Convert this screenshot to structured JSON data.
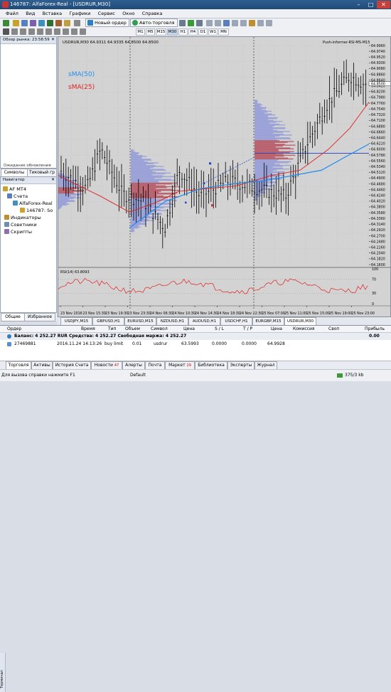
{
  "window": {
    "title": "146787: AlfaForex-Real - [USDRUR,M30]"
  },
  "menu": [
    "Файл",
    "Вид",
    "Вставка",
    "Графики",
    "Сервис",
    "Окно",
    "Справка"
  ],
  "toolbar": {
    "new_order": "Новый ордер",
    "auto_trading": "Авто-торговля",
    "timeframes": [
      "M1",
      "M5",
      "M15",
      "M30",
      "H1",
      "H4",
      "D1",
      "W1",
      "MN"
    ]
  },
  "market_watch": {
    "title": "Обзор рынка: 23:58:59",
    "status": "Ожидание обновления",
    "tabs": [
      "Символы",
      "Тиковый гр"
    ]
  },
  "navigator": {
    "title": "Навигатор",
    "items": [
      "AF MT4",
      "Счета",
      "AlfaForex-Real",
      "146787: So",
      "Индикаторы",
      "Советники",
      "Скрипты"
    ],
    "tabs": [
      "Общие",
      "Избранное"
    ]
  },
  "chart": {
    "header": "USDRUR,M30  64.9311 64.9335 64.8500 64.8500",
    "push_label": "Push-informer-RSI-MS-M15",
    "sma50_label": "sMA(50)",
    "sma25_label": "sMA(25)",
    "rsi_label": "RSI(14) 63.8093",
    "price_ticks": [
      "64.9960",
      "64.9740",
      "64.9520",
      "64.9300",
      "64.9080",
      "64.8860",
      "64.8640",
      "64.8420",
      "64.8200",
      "64.7980",
      "64.7760",
      "64.7540",
      "64.7320",
      "64.7100",
      "64.6880",
      "64.6660",
      "64.6440",
      "64.6220",
      "64.6000",
      "64.5780",
      "64.5560",
      "64.5340",
      "64.5120",
      "64.4900",
      "64.4680",
      "64.4460",
      "64.4240",
      "64.4020",
      "64.3800",
      "64.3580",
      "64.3360",
      "64.3140",
      "64.2920",
      "64.2700",
      "64.2480",
      "64.2260",
      "64.2040",
      "64.1820",
      "64.1600"
    ],
    "current_price": "64.8500",
    "rsi_ticks": [
      "100",
      "70",
      "30",
      "0"
    ],
    "time_ticks": [
      "23 Nov 2016",
      "23 Nov 15:30",
      "23 Nov 19:30",
      "23 Nov 23:30",
      "24 Nov 06:30",
      "24 Nov 10:30",
      "24 Nov 14:30",
      "24 Nov 18:30",
      "24 Nov 22:30",
      "25 Nov 07:00",
      "25 Nov 11:00",
      "25 Nov 15:00",
      "25 Nov 19:00",
      "25 Nov 23:00"
    ],
    "symbol_tabs": [
      "USDJPY,M15",
      "GBPUSD,H1",
      "EURUSD,M15",
      "NZDUSD,H1",
      "AUDUSD,H1",
      "USDCHF,H1",
      "EURGBP,M15",
      "USDRUR,M30"
    ],
    "colors": {
      "bg": "#d3d3d3",
      "candle": "#000000",
      "sma50": "#1e8cf0",
      "sma25": "#e02020",
      "profile": "#b04050"
    }
  },
  "terminal": {
    "headers": [
      "Ордер",
      "Время",
      "Тип",
      "Объем",
      "Символ",
      "Цена",
      "S / L",
      "T / P",
      "Цена",
      "Комиссия",
      "Своп",
      "Прибыль"
    ],
    "balance_line": "Баланс: 4 252.27 RUR  Средства: 4 252.27  Свободная маржа: 4 252.27",
    "balance_profit": "0.00",
    "order": {
      "id": "27469881",
      "time": "2016.11.24 14:13:26",
      "type": "buy limit",
      "volume": "0.01",
      "symbol": "usdrur",
      "price": "63.5993",
      "sl": "0.0000",
      "tp": "0.0000",
      "cur_price": "64.9928"
    },
    "side_label": "Терминал",
    "tabs": [
      "Торговля",
      "Активы",
      "История Счета",
      "Новости",
      "Алерты",
      "Почта",
      "Маркет",
      "Библиотека",
      "Эксперты",
      "Журнал"
    ],
    "tab_badges": {
      "news": "47",
      "market": "29"
    }
  },
  "statusbar": {
    "help": "Для вызова справки нажмите F1",
    "profile": "Default",
    "traffic": "375/3 kb"
  }
}
